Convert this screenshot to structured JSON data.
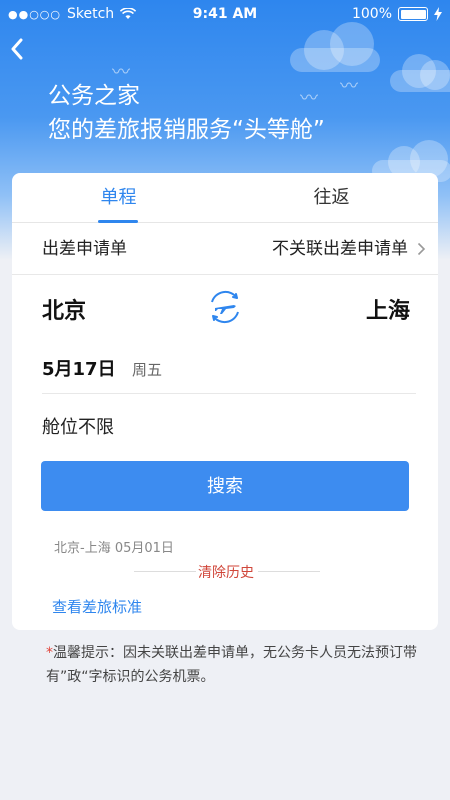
{
  "status_bar": {
    "carrier": "Sketch",
    "time": "9:41 AM",
    "battery": "100%"
  },
  "header": {
    "title": "公务之家",
    "subtitle": "您的差旅报销服务“头等舱”"
  },
  "tabs": [
    {
      "label": "单程",
      "active": true
    },
    {
      "label": "往返",
      "active": false
    }
  ],
  "apply": {
    "label": "出差申请单",
    "value": "不关联出差申请单"
  },
  "route": {
    "from": "北京",
    "to": "上海"
  },
  "date": {
    "value": "5月17日",
    "weekday": "周五"
  },
  "cabin": "舱位不限",
  "search_label": "搜索",
  "history": {
    "item": "北京-上海 05月01日",
    "clear_label": "清除历史"
  },
  "view_standard_label": "查看差旅标准",
  "tip": {
    "star": "*",
    "text": "温馨提示：因未关联出差申请单，无公务卡人员无法预订带有”政“字标识的公务机票。"
  },
  "colors": {
    "accent": "#2f86ee",
    "button": "#3d8cf0",
    "warning": "#d0463a"
  }
}
